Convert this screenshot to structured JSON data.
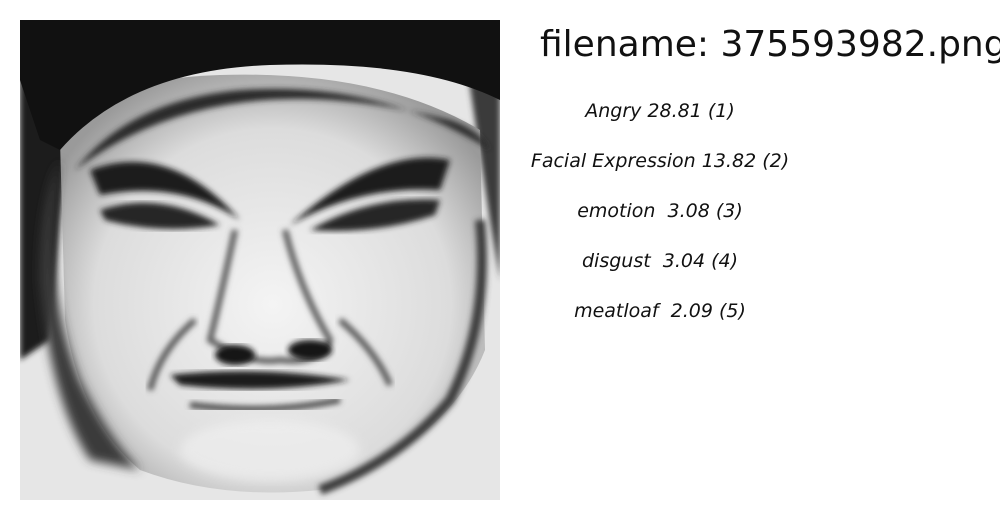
{
  "header": {
    "filename_text": "filename: 375593982.png"
  },
  "image": {
    "subject": "grayscale close-up of a face with an angry expression"
  },
  "labels": [
    {
      "text": "Angry 28.81 (1)"
    },
    {
      "text": "Facial Expression 13.82 (2)"
    },
    {
      "text": "emotion  3.08 (3)"
    },
    {
      "text": "disgust  3.04 (4)"
    },
    {
      "text": "meatloaf  2.09 (5)"
    }
  ]
}
